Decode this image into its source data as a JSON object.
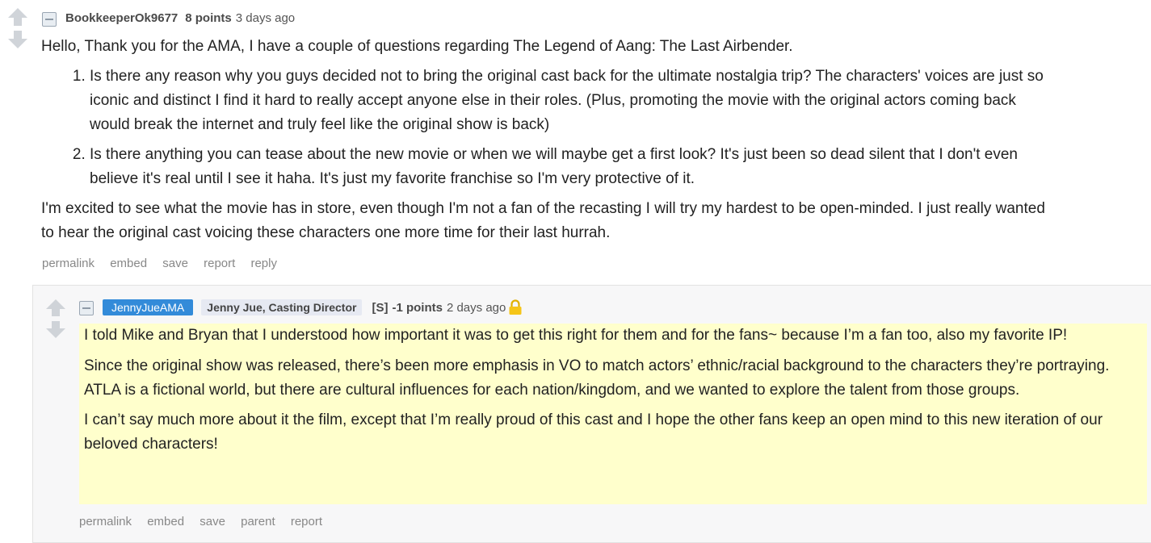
{
  "parent_comment": {
    "author": "BookkeeperOk9677",
    "score": "8 points",
    "time": "3 days ago",
    "intro": "Hello, Thank you for the AMA, I have a couple of questions regarding The Legend of Aang: The Last Airbender.",
    "questions": [
      "Is there any reason why you guys decided not to bring the original cast back for the ultimate nostalgia trip? The characters' voices are just so iconic and distinct I find it hard to really accept anyone else in their roles. (Plus, promoting the movie with the original actors coming back would break the internet and truly feel like the original show is back)",
      "Is there anything you can tease about the new movie or when we will maybe get a first look? It's just been so dead silent that I don't even believe it's real until I see it haha. It's just my favorite franchise so I'm very protective of it."
    ],
    "outro": "I'm excited to see what the movie has in store, even though I'm not a fan of the recasting I will try my hardest to be open-minded. I just really wanted to hear the original cast voicing these characters one more time for their last hurrah.",
    "buttons": [
      "permalink",
      "embed",
      "save",
      "report",
      "reply"
    ]
  },
  "reply_comment": {
    "author": "JennyJueAMA",
    "flair": "Jenny Jue, Casting Director",
    "stickied": "[S]",
    "score": "-1 points",
    "time": "2 days ago",
    "paragraphs": [
      "I told Mike and Bryan that I understood how important it was to get this right for them and for the fans~ because I’m a fan too, also my favorite IP!",
      "Since the original show was released, there’s been more emphasis in VO to match actors’ ethnic/racial background to the characters they’re portraying. ATLA is a fictional world, but there are cultural influences for each nation/kingdom, and we wanted to explore the talent from those groups.",
      "I can’t say much more about it the film, except that I’m really proud of this cast and I hope the other fans keep an open mind to this new iteration of our beloved characters!"
    ],
    "buttons": [
      "permalink",
      "embed",
      "save",
      "parent",
      "report"
    ]
  },
  "icons": {
    "upvote": "upvote-arrow-icon",
    "downvote": "downvote-arrow-icon",
    "collapse": "collapse-toggle-icon",
    "lock": "lock-icon"
  },
  "colors": {
    "op_flair": "#338bd9",
    "highlight": "#ffffcc",
    "lock": "#f5c518"
  }
}
